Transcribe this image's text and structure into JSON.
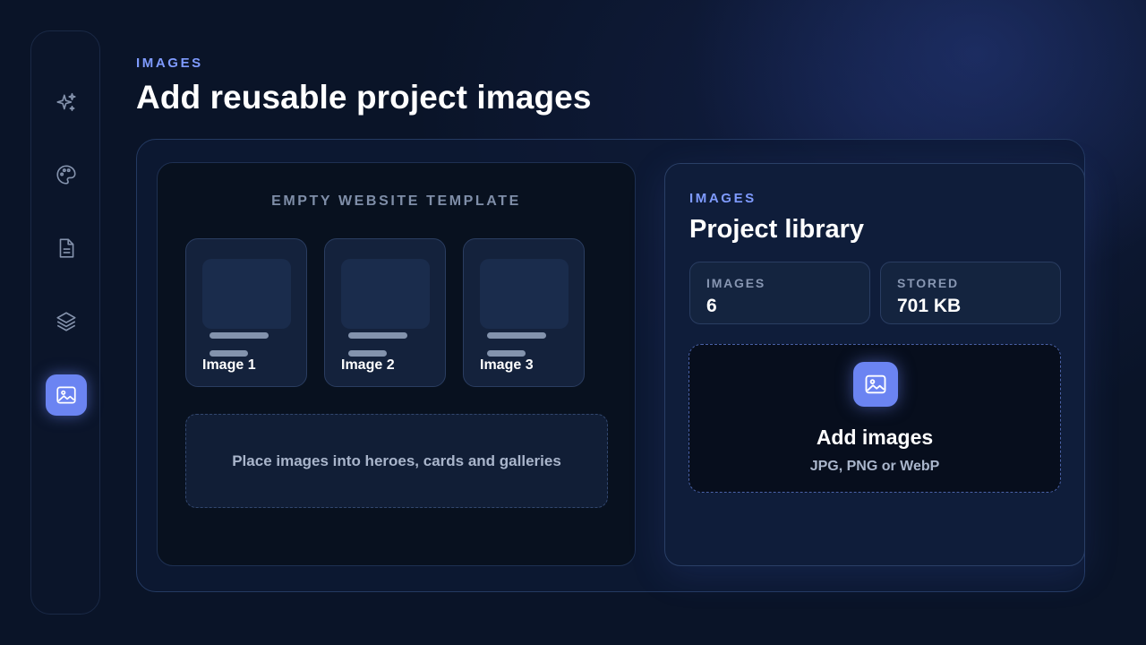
{
  "sidebar": {
    "items": [
      {
        "icon": "sparkles-icon",
        "active": false
      },
      {
        "icon": "palette-icon",
        "active": false
      },
      {
        "icon": "document-icon",
        "active": false
      },
      {
        "icon": "layers-icon",
        "active": false
      },
      {
        "icon": "image-icon",
        "active": true
      }
    ]
  },
  "header": {
    "eyebrow": "IMAGES",
    "title": "Add reusable project images"
  },
  "template": {
    "title": "EMPTY WEBSITE TEMPLATE",
    "cards": [
      {
        "label": "Image 1"
      },
      {
        "label": "Image 2"
      },
      {
        "label": "Image 3"
      }
    ],
    "hint": "Place images into heroes, cards and galleries"
  },
  "library": {
    "eyebrow": "IMAGES",
    "title": "Project library",
    "stats": [
      {
        "label": "IMAGES",
        "value": "6"
      },
      {
        "label": "STORED",
        "value": "701 KB"
      }
    ],
    "upload": {
      "icon": "image-icon",
      "title": "Add images",
      "subtitle": "JPG, PNG or WebP"
    }
  },
  "colors": {
    "accent": "#6b84f2",
    "eyebrow": "#7f9bff",
    "background": "#0a1428"
  }
}
